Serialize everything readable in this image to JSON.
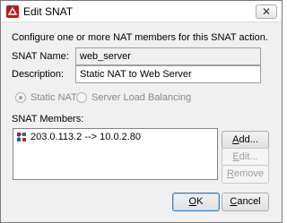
{
  "window": {
    "title": "Edit SNAT",
    "close_glyph": "✕"
  },
  "intro_text": "Configure one or more NAT members for this SNAT action.",
  "snat_name": {
    "label": "SNAT Name:",
    "value": "web_server"
  },
  "description": {
    "label": "Description:",
    "value": "Static NAT to Web Server"
  },
  "mode": {
    "options": [
      {
        "label": "Static NAT",
        "selected": true
      },
      {
        "label": "Server Load Balancing",
        "selected": false
      }
    ]
  },
  "members": {
    "label": "SNAT Members:",
    "items": [
      {
        "text": "203.0.113.2 --> 10.0.2.80",
        "icon": "nat-member-icon"
      }
    ]
  },
  "buttons": {
    "add": {
      "label": "Add...",
      "mnemonic": "A",
      "rest": "dd..."
    },
    "edit": {
      "label": "Edit...",
      "mnemonic": "E",
      "rest": "dit..."
    },
    "remove": {
      "label": "Remove",
      "mnemonic": "R",
      "rest": "emove"
    },
    "ok": {
      "label": "OK",
      "mnemonic": "O",
      "rest": "K"
    },
    "cancel": {
      "label": "Cancel",
      "mnemonic": "C",
      "rest": "ancel"
    }
  },
  "colors": {
    "app_icon": "#b71c1c",
    "dialog_background": "#f0f0f0",
    "default_button_border": "#3c7fb1"
  }
}
